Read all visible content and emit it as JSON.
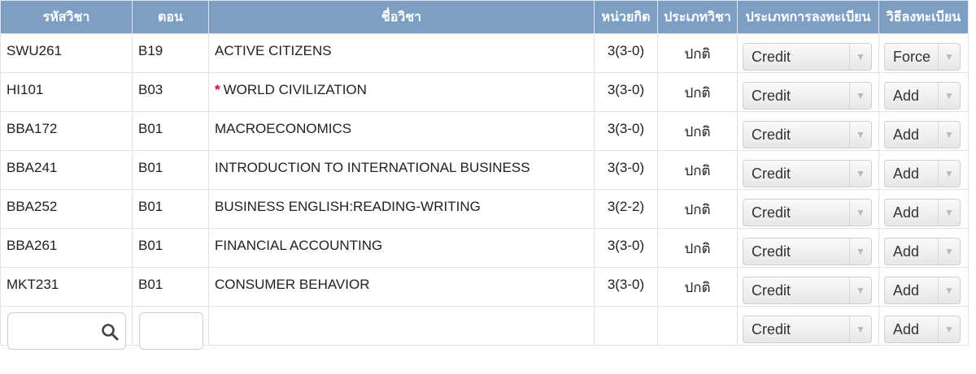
{
  "headers": {
    "code": "รหัสวิชา",
    "section": "ตอน",
    "name": "ชื่อวิชา",
    "credits": "หน่วยกิต",
    "course_type": "ประเภทวิชา",
    "reg_type": "ประเภทการลงทะเบียน",
    "reg_method": "วิธีลงทะเบียน"
  },
  "rows": [
    {
      "code": "SWU261",
      "section": "B19",
      "required_mark": "",
      "name": "ACTIVE CITIZENS",
      "credits": "3(3-0)",
      "course_type": "ปกติ",
      "reg_type": "Credit",
      "reg_method": "Force"
    },
    {
      "code": "HI101",
      "section": "B03",
      "required_mark": "*",
      "name": "WORLD CIVILIZATION",
      "credits": "3(3-0)",
      "course_type": "ปกติ",
      "reg_type": "Credit",
      "reg_method": "Add"
    },
    {
      "code": "BBA172",
      "section": "B01",
      "required_mark": "",
      "name": "MACROECONOMICS",
      "credits": "3(3-0)",
      "course_type": "ปกติ",
      "reg_type": "Credit",
      "reg_method": "Add"
    },
    {
      "code": "BBA241",
      "section": "B01",
      "required_mark": "",
      "name": "INTRODUCTION TO INTERNATIONAL BUSINESS",
      "credits": "3(3-0)",
      "course_type": "ปกติ",
      "reg_type": "Credit",
      "reg_method": "Add"
    },
    {
      "code": "BBA252",
      "section": "B01",
      "required_mark": "",
      "name": "BUSINESS ENGLISH:READING-WRITING",
      "credits": "3(2-2)",
      "course_type": "ปกติ",
      "reg_type": "Credit",
      "reg_method": "Add"
    },
    {
      "code": "BBA261",
      "section": "B01",
      "required_mark": "",
      "name": "FINANCIAL ACCOUNTING",
      "credits": "3(3-0)",
      "course_type": "ปกติ",
      "reg_type": "Credit",
      "reg_method": "Add"
    },
    {
      "code": "MKT231",
      "section": "B01",
      "required_mark": "",
      "name": "CONSUMER BEHAVIOR",
      "credits": "3(3-0)",
      "course_type": "ปกติ",
      "reg_type": "Credit",
      "reg_method": "Add"
    }
  ],
  "new_row": {
    "code_value": "",
    "section_value": "",
    "reg_type": "Credit",
    "reg_method": "Add",
    "search_icon": "search-icon"
  },
  "colors": {
    "header_bg": "#7d9fc4",
    "required_mark": "#d0021b"
  }
}
